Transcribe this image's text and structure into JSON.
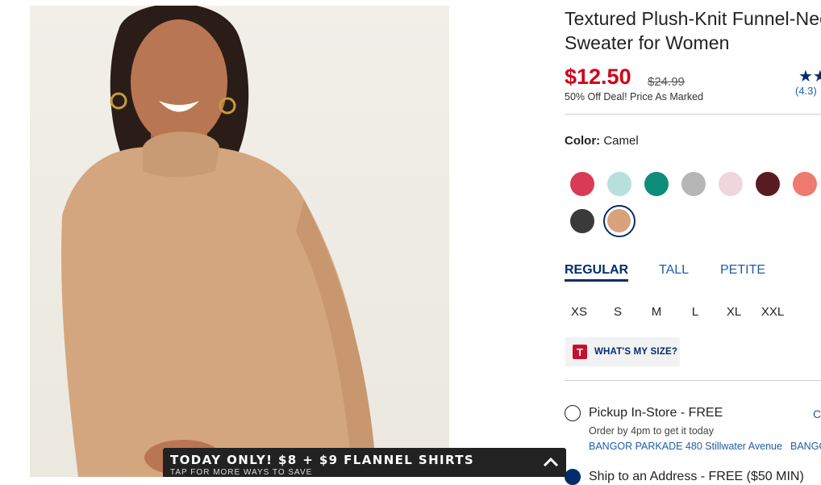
{
  "product": {
    "title_line1": "Textured Plush-Knit Funnel-Neck",
    "title_line2": "Sweater for Women",
    "price": "$12.50",
    "was_price": "$24.99",
    "deal_text": "50% Off Deal! Price As Marked",
    "stars_glyph": "★★",
    "rating": "(4.3)"
  },
  "color": {
    "label": "Color:",
    "value": "Camel",
    "swatches": [
      "#d83b53",
      "#b7dfdc",
      "#0c8c7a",
      "#b6b6b6",
      "#f0d6dc",
      "#5a1a22",
      "#ef7a6e",
      "#3a3a3a",
      "#d9a27d"
    ],
    "selected_index": 8
  },
  "fits": [
    "REGULAR",
    "TALL",
    "PETITE"
  ],
  "sizes": [
    "XS",
    "S",
    "M",
    "L",
    "XL",
    "XXL"
  ],
  "size_help": "WHAT'S MY SIZE?",
  "size_help_logo": "T",
  "fulfillment": {
    "pickup_label": "Pickup In-Store - FREE",
    "change_link": "C",
    "order_note": "Order by 4pm to get it today",
    "store_name": "BANGOR PARKADE 480 Stillwater Avenue",
    "store_name_repeat": "BANGOR",
    "ship_label": "Ship to an Address - FREE ($50 MIN)"
  },
  "promo_banner": {
    "headline": "TODAY ONLY! $8 + $9 FLANNEL SHIRTS",
    "subtext": "TAP FOR MORE WAYS TO SAVE"
  }
}
